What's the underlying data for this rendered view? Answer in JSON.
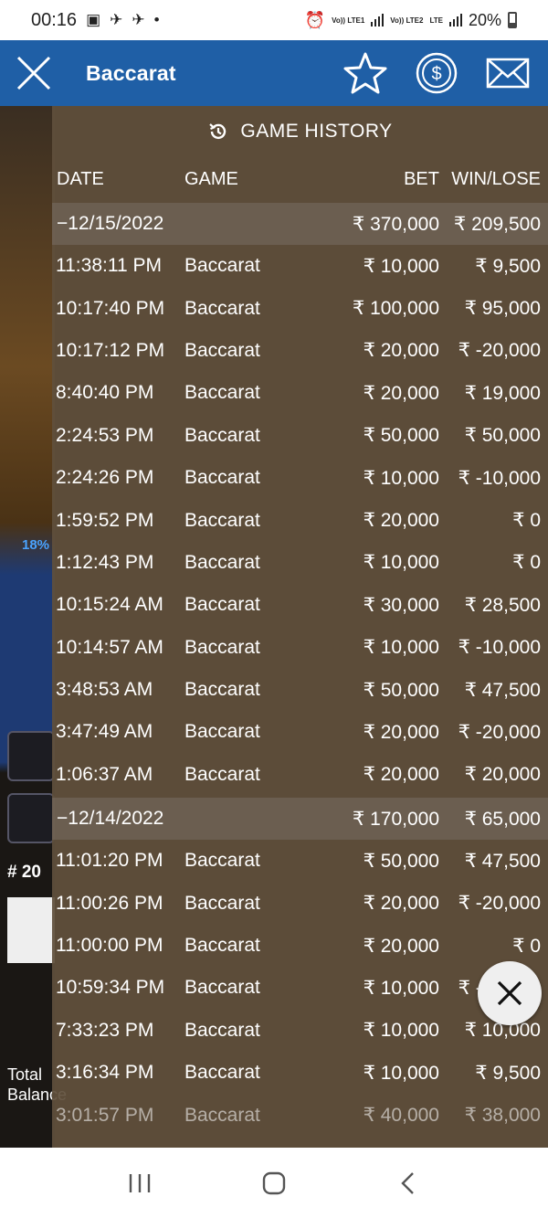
{
  "status": {
    "time": "00:16",
    "net1": "Vo)) LTE1",
    "net2": "Vo)) LTE2",
    "net3": "LTE",
    "battery": "20%"
  },
  "header": {
    "title": "Baccarat",
    "icons": [
      "close-icon",
      "star-icon",
      "dollar-icon",
      "mail-icon"
    ],
    "color": "#1f5fa6"
  },
  "background": {
    "percent": "18%",
    "round": "# 20",
    "total_label": "Total",
    "balance_label": "Balance"
  },
  "history": {
    "title": "GAME HISTORY",
    "columns": {
      "date": "DATE",
      "game": "GAME",
      "bet": "BET",
      "win": "WIN/LOSE"
    },
    "groups": [
      {
        "date": "−12/15/2022",
        "bet": "₹ 370,000",
        "win": "₹ 209,500",
        "rows": [
          {
            "time": "11:38:11 PM",
            "game": "Baccarat",
            "bet": "₹ 10,000",
            "win": "₹ 9,500"
          },
          {
            "time": "10:17:40 PM",
            "game": "Baccarat",
            "bet": "₹ 100,000",
            "win": "₹ 95,000"
          },
          {
            "time": "10:17:12 PM",
            "game": "Baccarat",
            "bet": "₹ 20,000",
            "win": "₹ -20,000"
          },
          {
            "time": "8:40:40 PM",
            "game": "Baccarat",
            "bet": "₹ 20,000",
            "win": "₹ 19,000"
          },
          {
            "time": "2:24:53 PM",
            "game": "Baccarat",
            "bet": "₹ 50,000",
            "win": "₹ 50,000"
          },
          {
            "time": "2:24:26 PM",
            "game": "Baccarat",
            "bet": "₹ 10,000",
            "win": "₹ -10,000"
          },
          {
            "time": "1:59:52 PM",
            "game": "Baccarat",
            "bet": "₹ 20,000",
            "win": "₹ 0"
          },
          {
            "time": "1:12:43 PM",
            "game": "Baccarat",
            "bet": "₹ 10,000",
            "win": "₹ 0"
          },
          {
            "time": "10:15:24 AM",
            "game": "Baccarat",
            "bet": "₹ 30,000",
            "win": "₹ 28,500"
          },
          {
            "time": "10:14:57 AM",
            "game": "Baccarat",
            "bet": "₹ 10,000",
            "win": "₹ -10,000"
          },
          {
            "time": "3:48:53 AM",
            "game": "Baccarat",
            "bet": "₹ 50,000",
            "win": "₹ 47,500"
          },
          {
            "time": "3:47:49 AM",
            "game": "Baccarat",
            "bet": "₹ 20,000",
            "win": "₹ -20,000"
          },
          {
            "time": "1:06:37 AM",
            "game": "Baccarat",
            "bet": "₹ 20,000",
            "win": "₹ 20,000"
          }
        ]
      },
      {
        "date": "−12/14/2022",
        "bet": "₹ 170,000",
        "win": "₹ 65,000",
        "rows": [
          {
            "time": "11:01:20 PM",
            "game": "Baccarat",
            "bet": "₹ 50,000",
            "win": "₹ 47,500"
          },
          {
            "time": "11:00:26 PM",
            "game": "Baccarat",
            "bet": "₹ 20,000",
            "win": "₹ -20,000"
          },
          {
            "time": "11:00:00 PM",
            "game": "Baccarat",
            "bet": "₹ 20,000",
            "win": "₹ 0"
          },
          {
            "time": "10:59:34 PM",
            "game": "Baccarat",
            "bet": "₹ 10,000",
            "win": "₹ -10,000"
          },
          {
            "time": "7:33:23 PM",
            "game": "Baccarat",
            "bet": "₹ 10,000",
            "win": "₹ 10,000"
          },
          {
            "time": "3:16:34 PM",
            "game": "Baccarat",
            "bet": "₹ 10,000",
            "win": "₹ 9,500"
          },
          {
            "time": "3:01:57 PM",
            "game": "Baccarat",
            "bet": "₹ 40,000",
            "win": "₹ 38,000"
          }
        ]
      }
    ]
  },
  "nav": {
    "icons": [
      "recent-apps-icon",
      "home-icon",
      "back-icon"
    ]
  }
}
